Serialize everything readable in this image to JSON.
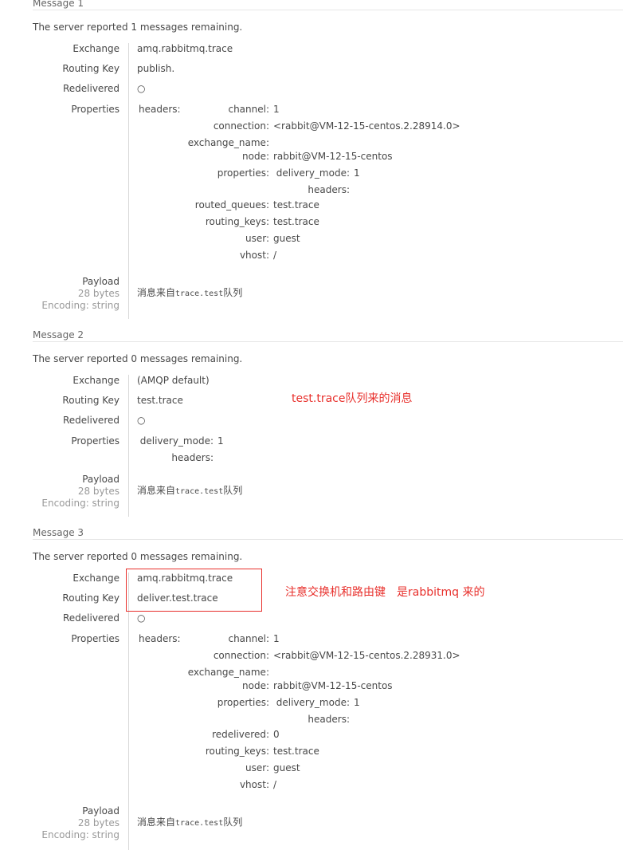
{
  "messages": [
    {
      "title": "Message 1",
      "server_line": "The server reported 1 messages remaining.",
      "labels": {
        "exchange": "Exchange",
        "routing_key": "Routing Key",
        "redelivered": "Redelivered",
        "properties": "Properties",
        "payload": "Payload",
        "bytes": "28 bytes",
        "encoding": "Encoding: string"
      },
      "exchange": "amq.rabbitmq.trace",
      "routing_key": "publish.",
      "redelivered": "○",
      "properties": [
        {
          "k": "headers:",
          "v": ""
        },
        {
          "k": "channel:",
          "v": "1"
        },
        {
          "k": "connection:",
          "v": "<rabbit@VM-12-15-centos.2.28914.0>"
        },
        {
          "k": "exchange_name:",
          "v": ""
        },
        {
          "k": "node:",
          "v": "rabbit@VM-12-15-centos"
        },
        {
          "k": "properties:",
          "v": ""
        },
        {
          "k": "delivery_mode:",
          "v": "1"
        },
        {
          "k": "headers:",
          "v": ""
        },
        {
          "k": "routed_queues:",
          "v": "test.trace"
        },
        {
          "k": "routing_keys:",
          "v": "test.trace"
        },
        {
          "k": "user:",
          "v": "guest"
        },
        {
          "k": "vhost:",
          "v": "/"
        }
      ],
      "payload": {
        "text1": "消息来自",
        "mono": "trace.test",
        "text2": "队列"
      }
    },
    {
      "title": "Message 2",
      "server_line": "The server reported 0 messages remaining.",
      "labels": {
        "exchange": "Exchange",
        "routing_key": "Routing Key",
        "redelivered": "Redelivered",
        "properties": "Properties",
        "payload": "Payload",
        "bytes": "28 bytes",
        "encoding": "Encoding: string"
      },
      "exchange": "(AMQP default)",
      "routing_key": "test.trace",
      "redelivered": "○",
      "properties": [
        {
          "k": "delivery_mode:",
          "v": "1"
        },
        {
          "k": "headers:",
          "v": ""
        }
      ],
      "payload": {
        "text1": "消息来自",
        "mono": "trace.test",
        "text2": "队列"
      }
    },
    {
      "title": "Message 3",
      "server_line": "The server reported 0 messages remaining.",
      "labels": {
        "exchange": "Exchange",
        "routing_key": "Routing Key",
        "redelivered": "Redelivered",
        "properties": "Properties",
        "payload": "Payload",
        "bytes": "28 bytes",
        "encoding": "Encoding: string"
      },
      "exchange": "amq.rabbitmq.trace",
      "routing_key": "deliver.test.trace",
      "redelivered": "○",
      "properties": [
        {
          "k": "headers:",
          "v": ""
        },
        {
          "k": "channel:",
          "v": "1"
        },
        {
          "k": "connection:",
          "v": "<rabbit@VM-12-15-centos.2.28931.0>"
        },
        {
          "k": "exchange_name:",
          "v": ""
        },
        {
          "k": "node:",
          "v": "rabbit@VM-12-15-centos"
        },
        {
          "k": "properties:",
          "v": ""
        },
        {
          "k": "delivery_mode:",
          "v": "1"
        },
        {
          "k": "headers:",
          "v": ""
        },
        {
          "k": "redelivered:",
          "v": "0"
        },
        {
          "k": "routing_keys:",
          "v": "test.trace"
        },
        {
          "k": "user:",
          "v": "guest"
        },
        {
          "k": "vhost:",
          "v": "/"
        }
      ],
      "payload": {
        "text1": "消息来自",
        "mono": "trace.test",
        "text2": "队列"
      }
    }
  ],
  "annotations": {
    "note_msg2": "test.trace队列来的消息",
    "note_msg3": "注意交换机和路由键　是rabbitmq 来的",
    "color": "#e8302c"
  }
}
